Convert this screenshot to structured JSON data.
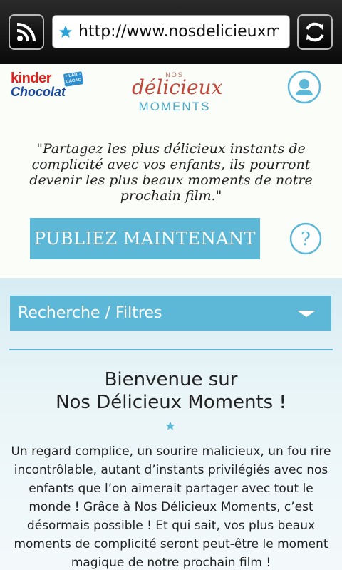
{
  "browser": {
    "url": "http://www.nosdelicieuxm...",
    "feed_icon": "rss-icon",
    "refresh_icon": "refresh-icon",
    "site_icon": "star-icon"
  },
  "header": {
    "brand_kinder": "kinder",
    "brand_chocolat": "Chocolat",
    "brand_badge": "+ LAIT - CACAO",
    "logo_nos": "NOS",
    "logo_delicieux": "délicieux",
    "logo_moments": "MOMENTS",
    "quote": "\"Partagez les plus délicieux instants de complicité avec vos enfants, ils pourront devenir les plus beaux moments de notre prochain film.\"",
    "publish_label": "PUBLIEZ MAINTENANT",
    "help_label": "?"
  },
  "content": {
    "filter_label": "Recherche / Filtres",
    "welcome_line1": "Bienvenue sur",
    "welcome_line2": "Nos Délicieux Moments !",
    "description": "Un regard complice, un sourire malicieux, un fou rire incontrôlable, autant d’instants privilégiés avec nos enfants que l’on aimerait partager avec tout le monde ! Grâce à Nos Délicieux Moments, c’est désormais possible ! Et qui sait, vos plus beaux moments de complicité seront peut-être le moment magique de notre prochain film !"
  },
  "colors": {
    "accent": "#5db7d6",
    "kinder_red": "#e0201c",
    "kinder_blue": "#1c4aa0",
    "logo_red": "#c4463a"
  }
}
